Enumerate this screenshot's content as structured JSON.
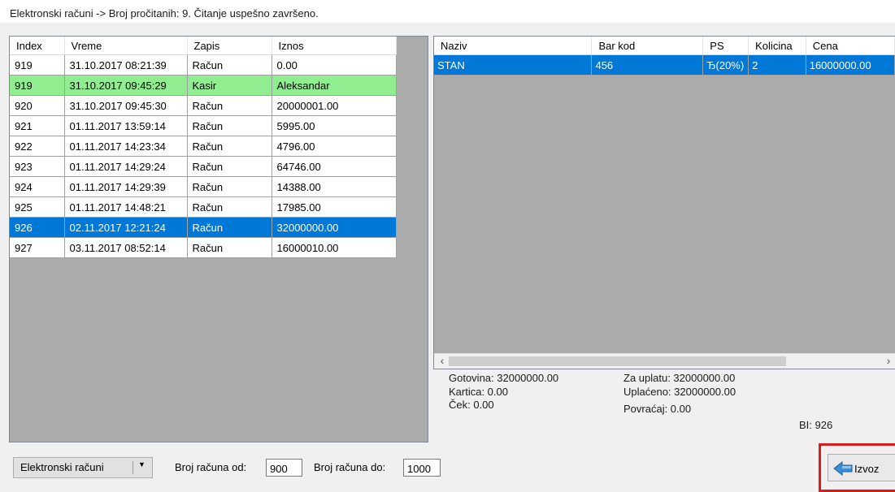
{
  "status": {
    "text": "Elektronski računi -> Broj pročitanih: 9. Čitanje uspešno završeno."
  },
  "left_table": {
    "columns": [
      "Index",
      "Vreme",
      "Zapis",
      "Iznos"
    ],
    "rows": [
      [
        "919",
        "31.10.2017 08:21:39",
        "Račun",
        "0.00"
      ],
      [
        "919",
        "31.10.2017 09:45:29",
        "Kasir",
        "Aleksandar"
      ],
      [
        "920",
        "31.10.2017 09:45:30",
        "Račun",
        "20000001.00"
      ],
      [
        "921",
        "01.11.2017 13:59:14",
        "Račun",
        "5995.00"
      ],
      [
        "922",
        "01.11.2017 14:23:34",
        "Račun",
        "4796.00"
      ],
      [
        "923",
        "01.11.2017 14:29:24",
        "Račun",
        "64746.00"
      ],
      [
        "924",
        "01.11.2017 14:29:39",
        "Račun",
        "14388.00"
      ],
      [
        "925",
        "01.11.2017 14:48:21",
        "Račun",
        "17985.00"
      ],
      [
        "926",
        "02.11.2017 12:21:24",
        "Račun",
        "32000000.00"
      ],
      [
        "927",
        "03.11.2017 08:52:14",
        "Račun",
        "16000010.00"
      ]
    ],
    "selected_row": 8,
    "highlighted_row": 1
  },
  "right_table": {
    "columns": [
      "Naziv",
      "Bar kod",
      "PS",
      "Kolicina",
      "Cena"
    ],
    "rows": [
      [
        "STAN",
        "456",
        "Ђ(20%)",
        "2",
        "16000000.00"
      ]
    ],
    "selected_row": 0
  },
  "totals": {
    "gotovina": "Gotovina: 32000000.00",
    "kartica": "Kartica: 0.00",
    "cek": "Ček: 0.00",
    "za_uplatu": "Za uplatu: 32000000.00",
    "uplaceno": "Uplaćeno: 32000000.00",
    "povracaj": "Povraćaj: 0.00",
    "bi": "BI: 926"
  },
  "controls": {
    "dropdown_value": "Elektronski računi",
    "from_label": "Broj računa od:",
    "from_value": "900",
    "to_label": "Broj računa do:",
    "to_value": "1000",
    "export_label": "Izvoz"
  },
  "colors": {
    "selection": "#0078d7",
    "highlight": "#90ee90",
    "grid_background": "#ababab",
    "export_outline": "#e01a1a"
  }
}
